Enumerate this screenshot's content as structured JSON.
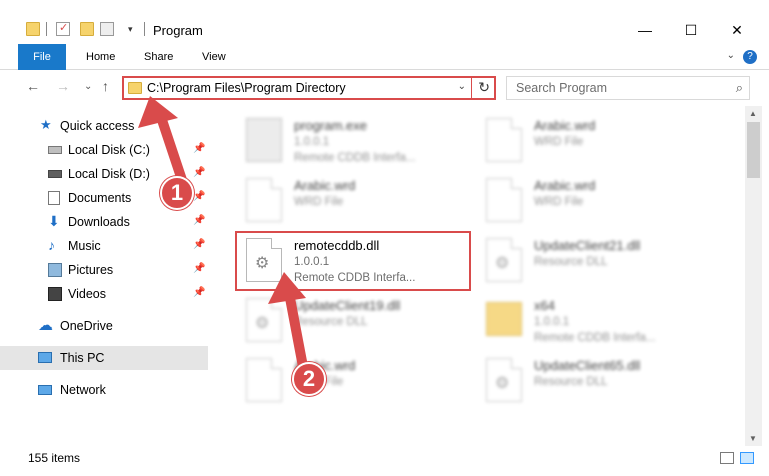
{
  "window": {
    "title": "Program",
    "minimize": "—",
    "maximize": "☐",
    "close": "✕"
  },
  "ribbon": {
    "tabs": [
      "File",
      "Home",
      "Share",
      "View"
    ],
    "help": "?",
    "collapse": "⌄"
  },
  "nav": {
    "back": "←",
    "forward": "→",
    "recent": "⌄",
    "up": "↑"
  },
  "address": {
    "path": "C:\\Program Files\\Program Directory",
    "dropdown": "⌄",
    "refresh": "↻"
  },
  "search": {
    "placeholder": "Search Program",
    "icon": "⌕"
  },
  "sidebar": {
    "items": [
      {
        "label": "Quick access",
        "icon": "star-icon",
        "pinned": false
      },
      {
        "label": "Local Disk (C:)",
        "icon": "drive-icon",
        "pinned": true
      },
      {
        "label": "Local Disk (D:)",
        "icon": "drive-icon",
        "pinned": true
      },
      {
        "label": "Documents",
        "icon": "documents-icon",
        "pinned": true
      },
      {
        "label": "Downloads",
        "icon": "download-icon",
        "pinned": true
      },
      {
        "label": "Music",
        "icon": "music-icon",
        "pinned": true
      },
      {
        "label": "Pictures",
        "icon": "pictures-icon",
        "pinned": true
      },
      {
        "label": "Videos",
        "icon": "videos-icon",
        "pinned": true
      },
      {
        "label": "OneDrive",
        "icon": "cloud-icon",
        "pinned": false
      },
      {
        "label": "This PC",
        "icon": "computer-icon",
        "pinned": false
      },
      {
        "label": "Network",
        "icon": "network-icon",
        "pinned": false
      }
    ],
    "pin_glyph": "📌"
  },
  "files": [
    {
      "name": "program.exe",
      "line2": "1.0.0.1",
      "line3": "Remote CDDB Interfa...",
      "blurred": true
    },
    {
      "name": "Arabic.wrd",
      "line2": "WRD File",
      "line3": "",
      "blurred": true
    },
    {
      "name": "Arabic.wrd",
      "line2": "WRD File",
      "line3": "",
      "blurred": true
    },
    {
      "name": "Arabic.wrd",
      "line2": "WRD File",
      "line3": "",
      "blurred": true
    },
    {
      "name": "remotecddb.dll",
      "line2": "1.0.0.1",
      "line3": "Remote CDDB Interfa...",
      "blurred": false
    },
    {
      "name": "UpdateClient21.dll",
      "line2": "Resource DLL",
      "line3": "",
      "blurred": true
    },
    {
      "name": "UpdateClient19.dll",
      "line2": "Resource DLL",
      "line3": "",
      "blurred": true
    },
    {
      "name": "x64",
      "line2": "1.0.0.1",
      "line3": "Remote CDDB Interfa...",
      "blurred": true
    },
    {
      "name": "Arabic.wrd",
      "line2": "WRD File",
      "line3": "",
      "blurred": true
    },
    {
      "name": "UpdateClient65.dll",
      "line2": "Resource DLL",
      "line3": "",
      "blurred": true
    }
  ],
  "annotations": {
    "step1": "1",
    "step2": "2",
    "accent": "#d94b4b"
  },
  "status": {
    "items_count": "155 items"
  },
  "colors": {
    "file_tab": "#1979ca",
    "selection": "#cce8ff",
    "highlight": "#d94b4b"
  }
}
